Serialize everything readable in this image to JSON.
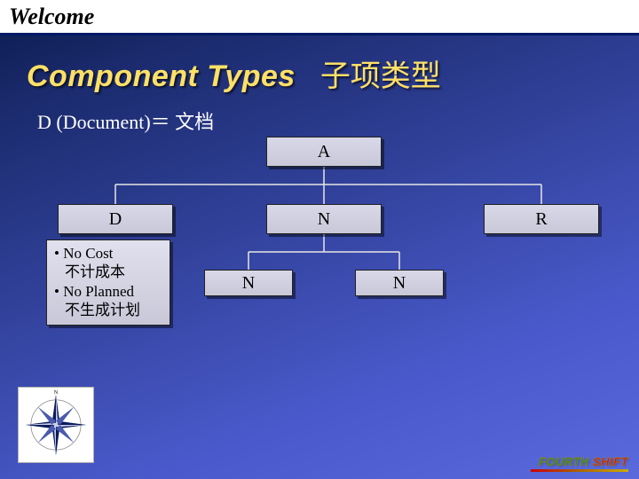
{
  "header": {
    "welcome": "Welcome"
  },
  "title": {
    "en": "Component Types",
    "zh": "子项类型"
  },
  "subtitle": "D (Document)＝ 文档",
  "tree": {
    "root": "A",
    "level1": {
      "left": "D",
      "mid": "N",
      "right": "R"
    },
    "level2": {
      "left": "N",
      "right": "N"
    }
  },
  "bullets": {
    "b1_en": "• No Cost",
    "b1_zh": "不计成本",
    "b2_en": "• No Planned",
    "b2_zh": "不生成计划"
  },
  "footer": {
    "brand_a": "FOURTH",
    "brand_b": " SHIFT"
  },
  "chart_data": {
    "type": "tree",
    "title": "Component Types 子项类型",
    "annotation_node": "D",
    "annotations": [
      "No Cost 不计成本",
      "No Planned 不生成计划"
    ],
    "nodes": [
      {
        "id": "A",
        "label": "A",
        "parent": null
      },
      {
        "id": "D",
        "label": "D",
        "parent": "A"
      },
      {
        "id": "N1",
        "label": "N",
        "parent": "A"
      },
      {
        "id": "R",
        "label": "R",
        "parent": "A"
      },
      {
        "id": "N2",
        "label": "N",
        "parent": "N1"
      },
      {
        "id": "N3",
        "label": "N",
        "parent": "N1"
      }
    ]
  }
}
